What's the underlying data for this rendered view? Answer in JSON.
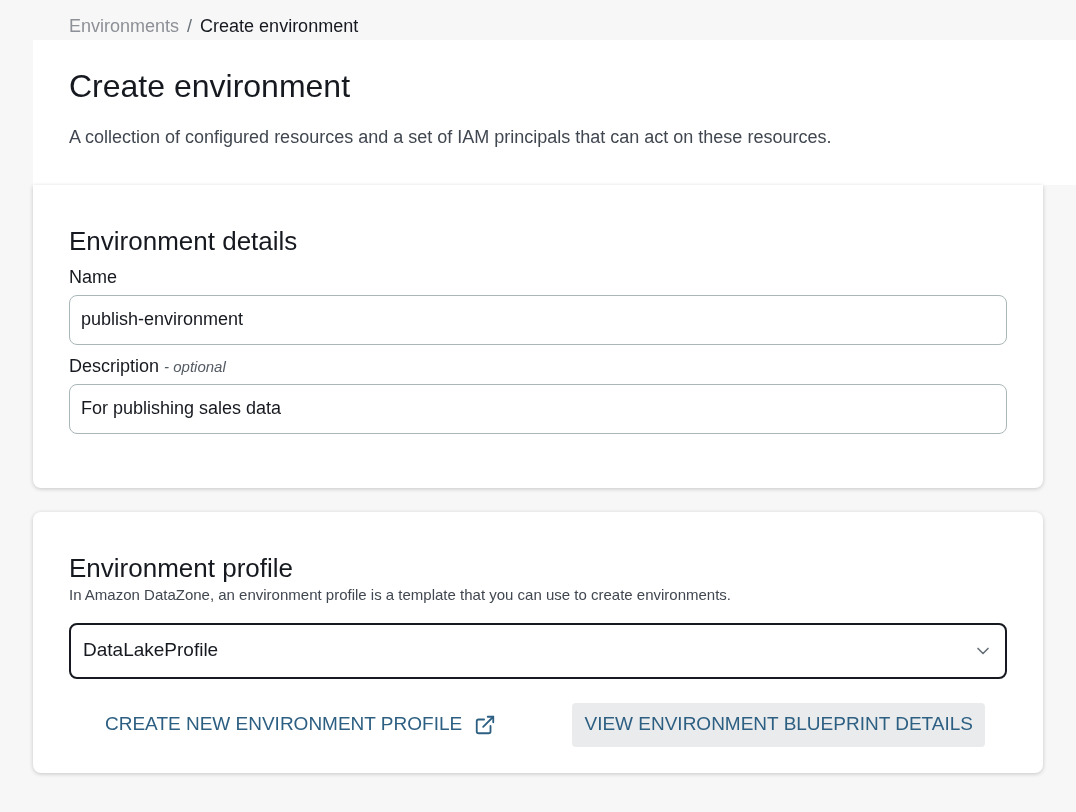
{
  "breadcrumb_separator": "/",
  "breadcrumb": [
    {
      "label": "Environments",
      "current": false
    },
    {
      "label": "Create environment",
      "current": true
    }
  ],
  "header": {
    "title": "Create environment",
    "description": "A collection of configured resources and a set of IAM principals that can act on these resources."
  },
  "details": {
    "title": "Environment details",
    "fields": [
      {
        "label": "Name",
        "value": "publish-environment"
      },
      {
        "label": "Description",
        "hint": "- optional",
        "value": "For publishing sales data"
      }
    ]
  },
  "profile": {
    "title": "Environment profile",
    "description": "In Amazon DataZone, an environment profile is a template that you can use to create environments.",
    "value": "DataLakeProfile",
    "actions": [
      {
        "label": "CREATE NEW ENVIRONMENT PROFILE",
        "kind": "external"
      },
      {
        "label": "VIEW ENVIRONMENT BLUEPRINT DETAILS",
        "kind": "filled"
      }
    ]
  }
}
